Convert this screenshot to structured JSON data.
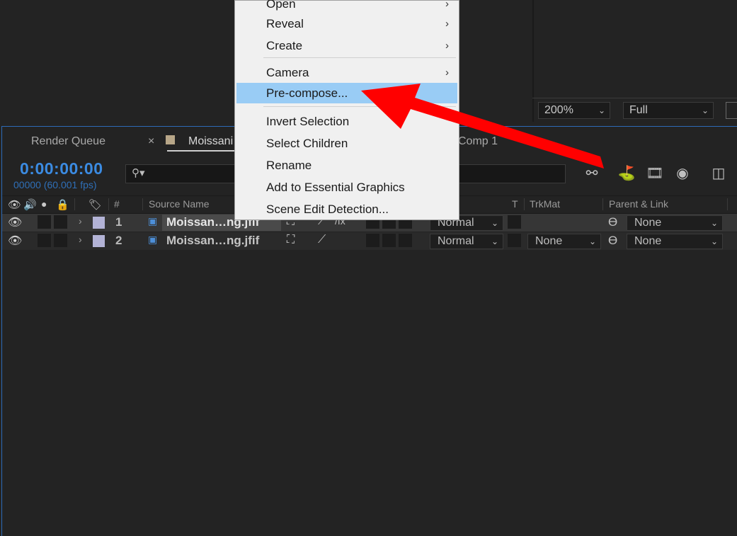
{
  "viewer": {
    "zoom": "200%",
    "resolution": "Full"
  },
  "tabs": [
    {
      "label": "Render Queue"
    },
    {
      "label": "Moissani",
      "close": "×"
    },
    {
      "label": "Comp 1"
    }
  ],
  "timeline": {
    "timecode": "0:00:00:00",
    "frames": "00000 (60.001 fps)",
    "search_placeholder": "",
    "columns": {
      "number": "#",
      "source_name": "Source Name",
      "t": "T",
      "trkmat": "TrkMat",
      "parent_link": "Parent & Link"
    },
    "layers": [
      {
        "number": "1",
        "name": "Moissan…ng.jfif",
        "mode": "Normal",
        "trkmat": "",
        "parent": "None"
      },
      {
        "number": "2",
        "name": "Moissan…ng.jfif",
        "mode": "Normal",
        "trkmat": "None",
        "parent": "None"
      }
    ]
  },
  "context_menu": {
    "items": [
      {
        "label": "Open",
        "submenu": true
      },
      {
        "label": "Reveal",
        "submenu": true
      },
      {
        "label": "Create",
        "submenu": true
      },
      {
        "label": "Camera",
        "submenu": true
      },
      {
        "label": "Pre-compose...",
        "highlighted": true
      },
      {
        "label": "Invert Selection"
      },
      {
        "label": "Select Children"
      },
      {
        "label": "Rename"
      },
      {
        "label": "Add to Essential Graphics"
      },
      {
        "label": "Scene Edit Detection..."
      }
    ]
  },
  "colors": {
    "accent": "#3b8be2",
    "menu_highlight": "#99ccf5",
    "arrow": "#ff0000",
    "label": "#b3b3d6"
  },
  "icons": [
    "eye-icon",
    "audio-icon",
    "solo-icon",
    "lock-icon",
    "label-tag-icon",
    "search-icon",
    "chevron-down-icon",
    "chevron-right-icon",
    "image-file-icon",
    "shy-icon",
    "graph-editor-icon",
    "motion-blur-icon",
    "frame-blend-icon",
    "draft-3d-icon",
    "spiral-pickwhip-icon"
  ]
}
